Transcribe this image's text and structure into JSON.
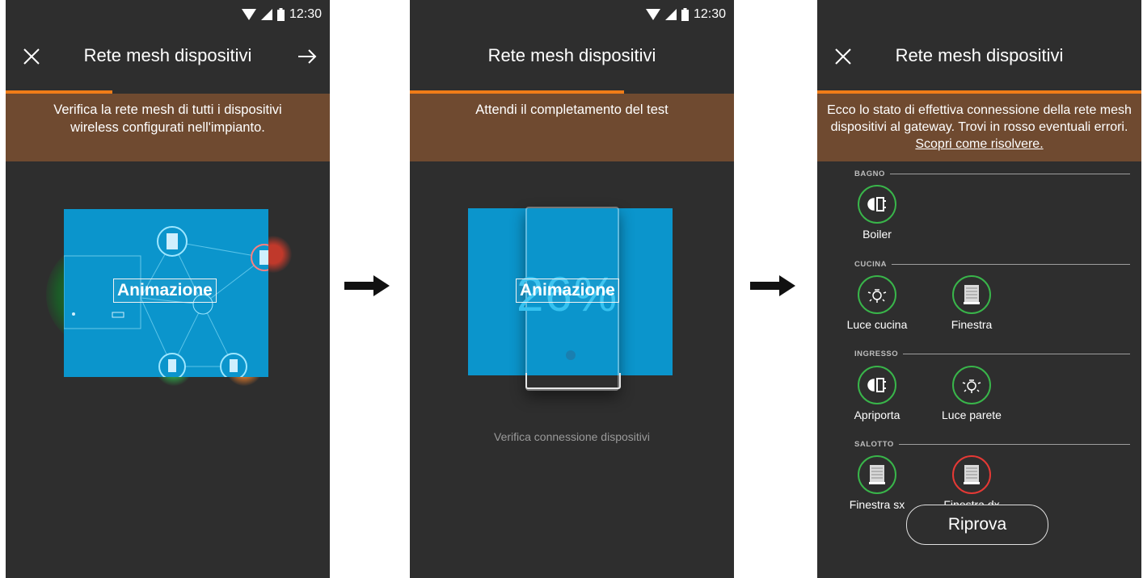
{
  "status": {
    "time": "12:30"
  },
  "screens": [
    {
      "title": "Rete mesh dispositivi",
      "progress": 0.33,
      "banner": "Verifica la rete mesh di tutti i dispositivi wireless configurati nell'impianto.",
      "animation_label": "Animazione"
    },
    {
      "title": "Rete mesh dispositivi",
      "progress": 0.66,
      "banner": "Attendi il completamento del test",
      "animation_label": "Animazione",
      "percent": "26%",
      "verify_text": "Verifica connessione dispositivi"
    },
    {
      "title": "Rete mesh dispositivi",
      "progress": 1.0,
      "banner_text": "Ecco lo stato di effettiva connessione della rete mesh dispositivi al gateway. Trovi in rosso eventuali errori.",
      "banner_link": "Scopri come risolvere.",
      "sections": [
        {
          "name": "BAGNO",
          "devices": [
            {
              "name": "Boiler",
              "icon": "lock-icon",
              "status": "ok"
            }
          ]
        },
        {
          "name": "CUCINA",
          "devices": [
            {
              "name": "Luce cucina",
              "icon": "bulb-icon",
              "status": "ok"
            },
            {
              "name": "Finestra",
              "icon": "shutter-icon",
              "status": "ok"
            }
          ]
        },
        {
          "name": "INGRESSO",
          "devices": [
            {
              "name": "Apriporta",
              "icon": "lock-icon",
              "status": "ok"
            },
            {
              "name": "Luce parete",
              "icon": "bulb-icon",
              "status": "ok"
            }
          ]
        },
        {
          "name": "SALOTTO",
          "devices": [
            {
              "name": "Finestra sx",
              "icon": "shutter-icon",
              "status": "ok"
            },
            {
              "name": "Finestra dx",
              "icon": "shutter-icon",
              "status": "error"
            }
          ]
        }
      ],
      "retry_label": "Riprova"
    }
  ],
  "colors": {
    "accent": "#f07c18",
    "banner": "#6f4a30",
    "ok": "#39b54a",
    "error": "#e53935",
    "anim": "#0b95cc"
  }
}
